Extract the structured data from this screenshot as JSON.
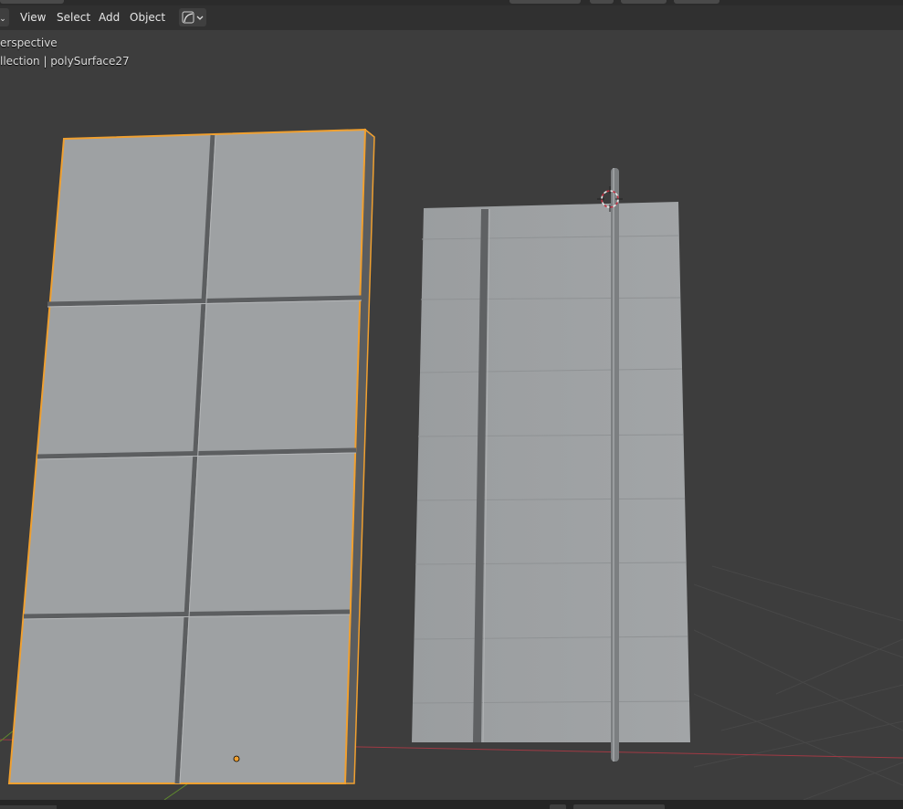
{
  "header": {
    "menus": [
      "View",
      "Select",
      "Add",
      "Object"
    ],
    "shading_icon": "curve-icon",
    "mode_icon": "chevron-down-icon"
  },
  "viewport": {
    "view_name": "erspective",
    "collection_path": "llection | polySurface27"
  },
  "colors": {
    "background": "#3d3d3d",
    "selection_outline": "#f0a030",
    "x_axis": "#a03a44",
    "y_axis": "#5f8a2e",
    "mesh": "#999c9e"
  }
}
